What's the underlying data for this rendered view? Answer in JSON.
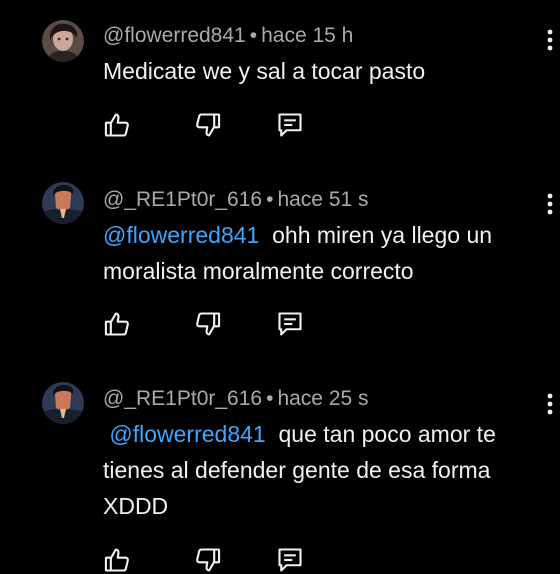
{
  "comments": [
    {
      "handle": "@flowerred841",
      "separator": "•",
      "time": "hace 15 h",
      "mention": "",
      "text": "Medicate we y sal a tocar pasto",
      "avatar": "avatar-flowerred",
      "menu_icon": "more-vert-icon"
    },
    {
      "handle": "@_RE1Pt0r_616",
      "separator": "•",
      "time": "hace 51 s",
      "mention": "@flowerred841",
      "text": "  ohh miren ya llego un moralista moralmente correcto",
      "avatar": "avatar-re1pt0r",
      "menu_icon": "more-vert-icon"
    },
    {
      "handle": "@_RE1Pt0r_616",
      "separator": "•",
      "time": "hace 25 s",
      "mention": " @flowerred841",
      "text": "  que tan poco amor te tienes al defender gente de esa forma XDDD",
      "avatar": "avatar-re1pt0r",
      "menu_icon": "more-vert-icon"
    }
  ],
  "action_icons": [
    "like-icon",
    "dislike-icon",
    "reply-icon"
  ],
  "colors": {
    "background": "#000000",
    "text": "#f1f1f1",
    "meta": "#aaaaaa",
    "mention": "#3ea6ff"
  }
}
